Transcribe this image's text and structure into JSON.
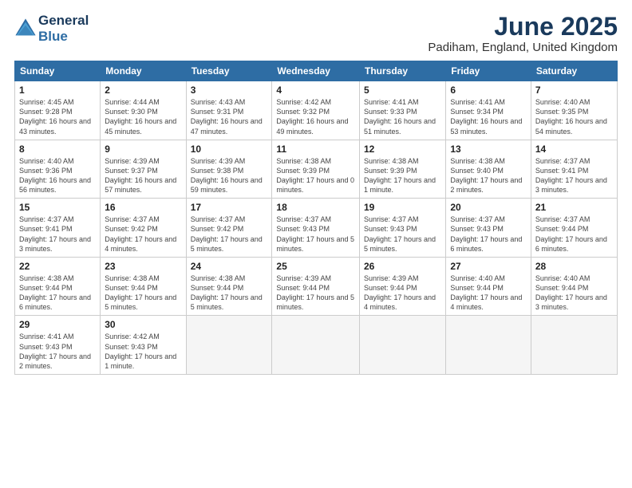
{
  "logo": {
    "line1": "General",
    "line2": "Blue"
  },
  "title": "June 2025",
  "location": "Padiham, England, United Kingdom",
  "days_of_week": [
    "Sunday",
    "Monday",
    "Tuesday",
    "Wednesday",
    "Thursday",
    "Friday",
    "Saturday"
  ],
  "weeks": [
    [
      {
        "day": "1",
        "info": "Sunrise: 4:45 AM\nSunset: 9:28 PM\nDaylight: 16 hours and 43 minutes."
      },
      {
        "day": "2",
        "info": "Sunrise: 4:44 AM\nSunset: 9:30 PM\nDaylight: 16 hours and 45 minutes."
      },
      {
        "day": "3",
        "info": "Sunrise: 4:43 AM\nSunset: 9:31 PM\nDaylight: 16 hours and 47 minutes."
      },
      {
        "day": "4",
        "info": "Sunrise: 4:42 AM\nSunset: 9:32 PM\nDaylight: 16 hours and 49 minutes."
      },
      {
        "day": "5",
        "info": "Sunrise: 4:41 AM\nSunset: 9:33 PM\nDaylight: 16 hours and 51 minutes."
      },
      {
        "day": "6",
        "info": "Sunrise: 4:41 AM\nSunset: 9:34 PM\nDaylight: 16 hours and 53 minutes."
      },
      {
        "day": "7",
        "info": "Sunrise: 4:40 AM\nSunset: 9:35 PM\nDaylight: 16 hours and 54 minutes."
      }
    ],
    [
      {
        "day": "8",
        "info": "Sunrise: 4:40 AM\nSunset: 9:36 PM\nDaylight: 16 hours and 56 minutes."
      },
      {
        "day": "9",
        "info": "Sunrise: 4:39 AM\nSunset: 9:37 PM\nDaylight: 16 hours and 57 minutes."
      },
      {
        "day": "10",
        "info": "Sunrise: 4:39 AM\nSunset: 9:38 PM\nDaylight: 16 hours and 59 minutes."
      },
      {
        "day": "11",
        "info": "Sunrise: 4:38 AM\nSunset: 9:39 PM\nDaylight: 17 hours and 0 minutes."
      },
      {
        "day": "12",
        "info": "Sunrise: 4:38 AM\nSunset: 9:39 PM\nDaylight: 17 hours and 1 minute."
      },
      {
        "day": "13",
        "info": "Sunrise: 4:38 AM\nSunset: 9:40 PM\nDaylight: 17 hours and 2 minutes."
      },
      {
        "day": "14",
        "info": "Sunrise: 4:37 AM\nSunset: 9:41 PM\nDaylight: 17 hours and 3 minutes."
      }
    ],
    [
      {
        "day": "15",
        "info": "Sunrise: 4:37 AM\nSunset: 9:41 PM\nDaylight: 17 hours and 3 minutes."
      },
      {
        "day": "16",
        "info": "Sunrise: 4:37 AM\nSunset: 9:42 PM\nDaylight: 17 hours and 4 minutes."
      },
      {
        "day": "17",
        "info": "Sunrise: 4:37 AM\nSunset: 9:42 PM\nDaylight: 17 hours and 5 minutes."
      },
      {
        "day": "18",
        "info": "Sunrise: 4:37 AM\nSunset: 9:43 PM\nDaylight: 17 hours and 5 minutes."
      },
      {
        "day": "19",
        "info": "Sunrise: 4:37 AM\nSunset: 9:43 PM\nDaylight: 17 hours and 5 minutes."
      },
      {
        "day": "20",
        "info": "Sunrise: 4:37 AM\nSunset: 9:43 PM\nDaylight: 17 hours and 6 minutes."
      },
      {
        "day": "21",
        "info": "Sunrise: 4:37 AM\nSunset: 9:44 PM\nDaylight: 17 hours and 6 minutes."
      }
    ],
    [
      {
        "day": "22",
        "info": "Sunrise: 4:38 AM\nSunset: 9:44 PM\nDaylight: 17 hours and 6 minutes."
      },
      {
        "day": "23",
        "info": "Sunrise: 4:38 AM\nSunset: 9:44 PM\nDaylight: 17 hours and 5 minutes."
      },
      {
        "day": "24",
        "info": "Sunrise: 4:38 AM\nSunset: 9:44 PM\nDaylight: 17 hours and 5 minutes."
      },
      {
        "day": "25",
        "info": "Sunrise: 4:39 AM\nSunset: 9:44 PM\nDaylight: 17 hours and 5 minutes."
      },
      {
        "day": "26",
        "info": "Sunrise: 4:39 AM\nSunset: 9:44 PM\nDaylight: 17 hours and 4 minutes."
      },
      {
        "day": "27",
        "info": "Sunrise: 4:40 AM\nSunset: 9:44 PM\nDaylight: 17 hours and 4 minutes."
      },
      {
        "day": "28",
        "info": "Sunrise: 4:40 AM\nSunset: 9:44 PM\nDaylight: 17 hours and 3 minutes."
      }
    ],
    [
      {
        "day": "29",
        "info": "Sunrise: 4:41 AM\nSunset: 9:43 PM\nDaylight: 17 hours and 2 minutes."
      },
      {
        "day": "30",
        "info": "Sunrise: 4:42 AM\nSunset: 9:43 PM\nDaylight: 17 hours and 1 minute."
      },
      {
        "day": "",
        "info": ""
      },
      {
        "day": "",
        "info": ""
      },
      {
        "day": "",
        "info": ""
      },
      {
        "day": "",
        "info": ""
      },
      {
        "day": "",
        "info": ""
      }
    ]
  ]
}
